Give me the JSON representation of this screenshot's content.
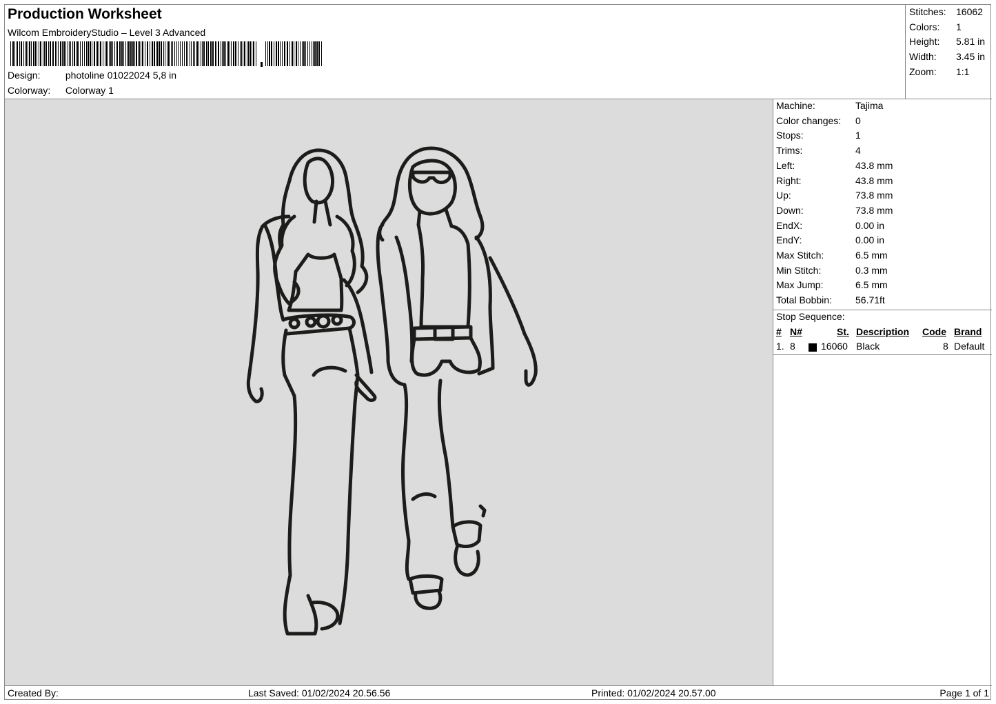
{
  "header": {
    "title": "Production Worksheet",
    "subtitle": "Wilcom EmbroideryStudio – Level 3 Advanced",
    "design_label": "Design:",
    "design_value": "photoline 01022024 5,8 in",
    "colorway_label": "Colorway:",
    "colorway_value": "Colorway 1"
  },
  "stats": [
    {
      "label": "Stitches:",
      "value": "16062"
    },
    {
      "label": "Colors:",
      "value": "1"
    },
    {
      "label": "Height:",
      "value": "5.81 in"
    },
    {
      "label": "Width:",
      "value": "3.45 in"
    },
    {
      "label": "Zoom:",
      "value": "1:1"
    }
  ],
  "machine_info": [
    {
      "label": "Machine:",
      "value": "Tajima"
    },
    {
      "label": "Color changes:",
      "value": "0"
    },
    {
      "label": "Stops:",
      "value": "1"
    },
    {
      "label": "Trims:",
      "value": "4"
    },
    {
      "label": "Left:",
      "value": "43.8 mm"
    },
    {
      "label": "Right:",
      "value": "43.8 mm"
    },
    {
      "label": "Up:",
      "value": "73.8 mm"
    },
    {
      "label": "Down:",
      "value": "73.8 mm"
    },
    {
      "label": "EndX:",
      "value": "0.00 in"
    },
    {
      "label": "EndY:",
      "value": "0.00 in"
    },
    {
      "label": "Max Stitch:",
      "value": "6.5 mm"
    },
    {
      "label": "Min Stitch:",
      "value": "0.3 mm"
    },
    {
      "label": "Max Jump:",
      "value": "6.5 mm"
    },
    {
      "label": "Total Bobbin:",
      "value": "56.71ft"
    }
  ],
  "stop_sequence": {
    "title": "Stop Sequence:",
    "columns": {
      "num": "#",
      "n": "N#",
      "st": "St.",
      "description": "Description",
      "code": "Code",
      "brand": "Brand"
    },
    "rows": [
      {
        "num": "1.",
        "n": "8",
        "st": "16060",
        "description": "Black",
        "code": "8",
        "brand": "Default",
        "color": "#000000"
      }
    ]
  },
  "footer": {
    "created_by": "Created By:",
    "last_saved": "Last Saved: 01/02/2024 20.56.56",
    "printed": "Printed: 01/02/2024 20.57.00",
    "page": "Page 1 of 1"
  },
  "colors": {
    "preview_bg": "#dcdcdc",
    "stitch": "#1c1c1a",
    "border": "#8a8a8a"
  }
}
